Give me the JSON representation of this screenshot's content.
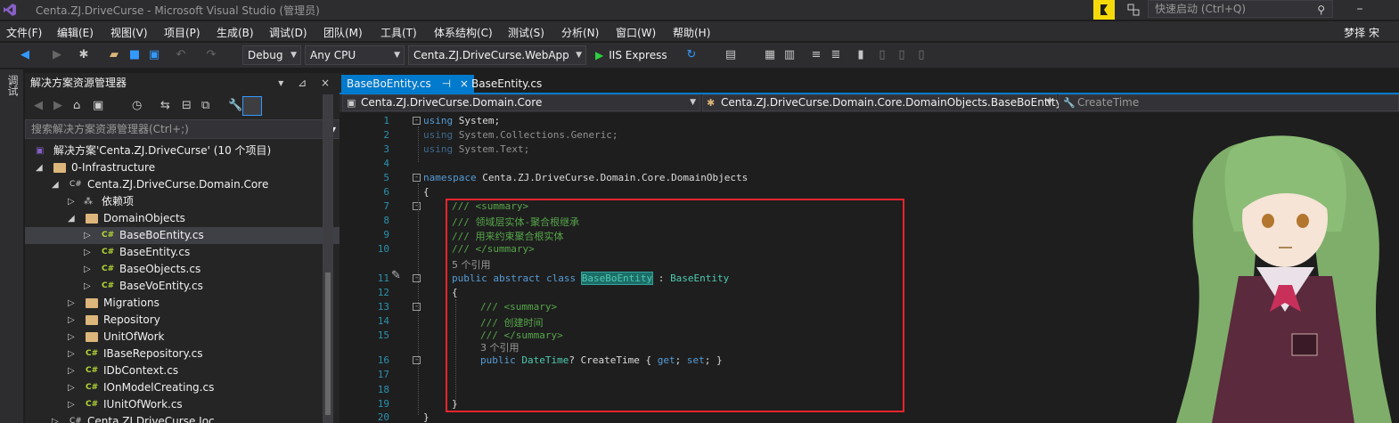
{
  "window": {
    "title": "Centa.ZJ.DriveCurse - Microsoft Visual Studio (管理员)",
    "quick_launch_placeholder": "快速启动 (Ctrl+Q)",
    "user": "梦择 宋"
  },
  "menu": [
    "文件(F)",
    "编辑(E)",
    "视图(V)",
    "项目(P)",
    "生成(B)",
    "调试(D)",
    "团队(M)",
    "工具(T)",
    "体系结构(C)",
    "测试(S)",
    "分析(N)",
    "窗口(W)",
    "帮助(H)"
  ],
  "toolbar": {
    "config": "Debug",
    "platform": "Any CPU",
    "startup_project": "Centa.ZJ.DriveCurse.WebApp",
    "run_label": "IIS Express"
  },
  "side_strip": {
    "label": "调试"
  },
  "solution_explorer": {
    "title": "解决方案资源管理器",
    "search_placeholder": "搜索解决方案资源管理器(Ctrl+;)",
    "items": [
      {
        "label": "解决方案'Centa.ZJ.DriveCurse' (10 个项目)",
        "kind": "solution"
      },
      {
        "label": "0-Infrastructure",
        "kind": "folder"
      },
      {
        "label": "Centa.ZJ.DriveCurse.Domain.Core",
        "kind": "project"
      },
      {
        "label": "依赖项",
        "kind": "deps"
      },
      {
        "label": "DomainObjects",
        "kind": "folder"
      },
      {
        "label": "BaseBoEntity.cs",
        "kind": "cs"
      },
      {
        "label": "BaseEntity.cs",
        "kind": "cs"
      },
      {
        "label": "BaseObjects.cs",
        "kind": "cs"
      },
      {
        "label": "BaseVoEntity.cs",
        "kind": "cs"
      },
      {
        "label": "Migrations",
        "kind": "folder"
      },
      {
        "label": "Repository",
        "kind": "folder"
      },
      {
        "label": "UnitOfWork",
        "kind": "folder"
      },
      {
        "label": "IBaseRepository.cs",
        "kind": "cs"
      },
      {
        "label": "IDbContext.cs",
        "kind": "cs"
      },
      {
        "label": "IOnModelCreating.cs",
        "kind": "cs"
      },
      {
        "label": "IUnitOfWork.cs",
        "kind": "cs"
      },
      {
        "label": "Centa.ZJ.DriveCurse.Ioc",
        "kind": "project"
      }
    ]
  },
  "editor": {
    "tabs": [
      "BaseBoEntity.cs",
      "BaseEntity.cs"
    ],
    "nav_project": "Centa.ZJ.DriveCurse.Domain.Core",
    "nav_type": "Centa.ZJ.DriveCurse.Domain.Core.DomainObjects.BaseBoEntity",
    "nav_member": "CreateTime",
    "line_numbers": [
      "1",
      "2",
      "3",
      "4",
      "5",
      "6",
      "7",
      "8",
      "9",
      "10",
      "",
      "11",
      "12",
      "13",
      "14",
      "15",
      "",
      "16",
      "17",
      "18",
      "19",
      "20"
    ],
    "code": {
      "l1_kw": "using",
      "l1_rest": " System;",
      "l2_kw": "using",
      "l2_rest": " System.Collections.Generic;",
      "l3_kw": "using",
      "l3_rest": " System.Text;",
      "l5_kw": "namespace",
      "l5_rest": " Centa.ZJ.DriveCurse.Domain.Core.DomainObjects",
      "l6": "{",
      "l7": "/// <summary>",
      "l8": "/// 领域层实体-聚合根继承",
      "l9": "/// 用来约束聚合根实体",
      "l10": "/// </summary>",
      "ref1": "5 个引用",
      "l11_kw": "public abstract class",
      "l11_name": "BaseBoEntity",
      "l11_rest": " : ",
      "l11_base": "BaseEntity",
      "l12": "{",
      "l13": "/// <summary>",
      "l14": "/// 创建时间",
      "l15": "/// </summary>",
      "ref2": "3 个引用",
      "l16_kw": "public",
      "l16_type": "DateTime",
      "l16_rest": "? CreateTime { ",
      "l16_get": "get",
      "l16_mid": "; ",
      "l16_set": "set",
      "l16_end": "; }",
      "l19": "}",
      "l20": "}"
    }
  },
  "colors": {
    "accent": "#007acc",
    "highlight_box": "#e8252e"
  }
}
